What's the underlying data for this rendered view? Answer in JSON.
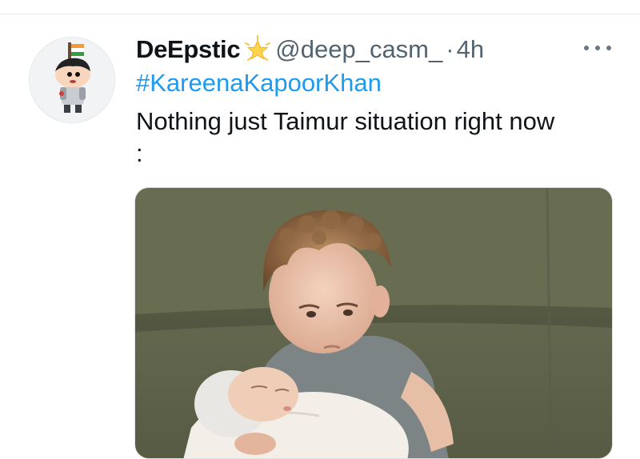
{
  "tweet": {
    "display_name": "DeEpstic",
    "name_badge": "glowing-star-emoji",
    "handle": "@deep_casm_",
    "separator": "·",
    "time": "4h",
    "hashtag": "#KareenaKapoorKhan",
    "text": "Nothing just Taimur situation right now\n:",
    "more_icon": "more-horizontal-icon",
    "media_description": "toddler-holding-newborn-photo"
  },
  "colors": {
    "link": "#1d9bf0",
    "text": "#0f1419",
    "secondary": "#536471"
  }
}
